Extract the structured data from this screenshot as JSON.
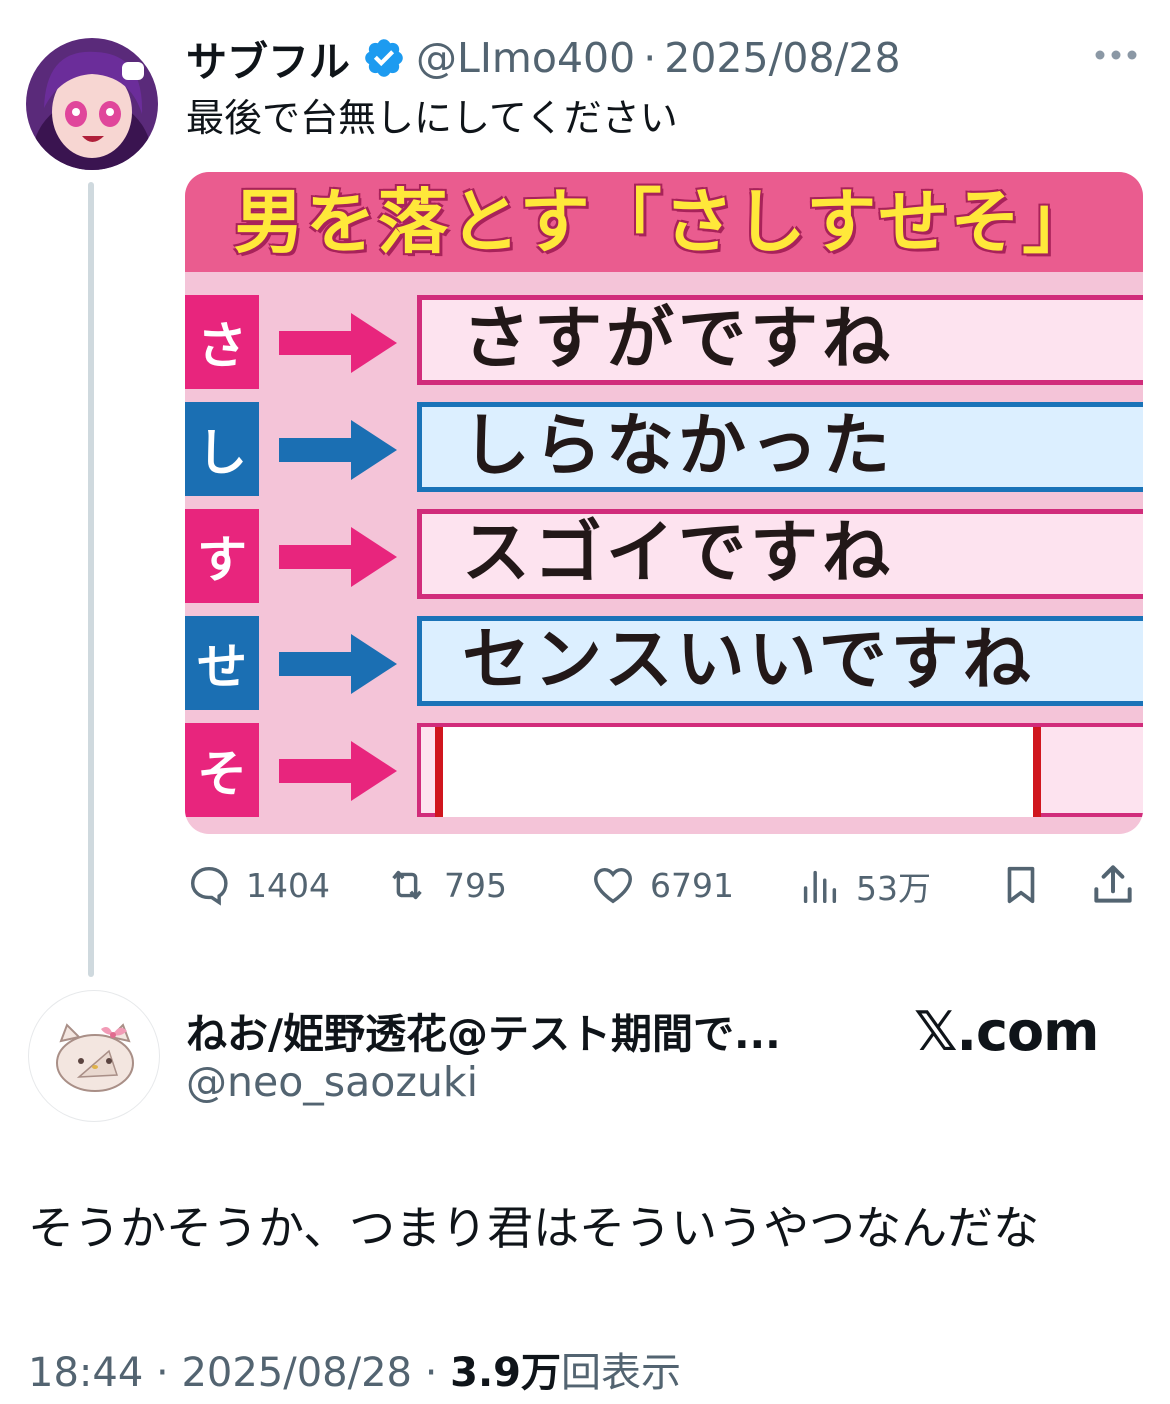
{
  "tweet": {
    "author_name": "サブフル",
    "handle": "@LImo400",
    "separator": "·",
    "date": "2025/08/28",
    "text": "最後で台無しにしてください"
  },
  "image": {
    "title": "男を落とす「さしすせそ」",
    "rows": [
      {
        "label": "さ",
        "answer": "さすがですね",
        "color": "pink"
      },
      {
        "label": "し",
        "answer": "しらなかった",
        "color": "blue"
      },
      {
        "label": "す",
        "answer": "スゴイですね",
        "color": "pink"
      },
      {
        "label": "せ",
        "answer": "センスいいですね",
        "color": "blue"
      },
      {
        "label": "そ",
        "answer": "",
        "color": "pink"
      }
    ]
  },
  "actions": {
    "replies": "1404",
    "retweets": "795",
    "likes": "6791",
    "views": "53万"
  },
  "reply_account": {
    "name": "ねお/姫野透花@テスト期間で...",
    "handle": "@neo_saozuki",
    "site": "𝕏.com"
  },
  "reply": {
    "text": "そうかそうか、つまり君はそういうやつなんだな",
    "time": "18:44",
    "separator": "·",
    "date": "2025/08/28",
    "views_count": "3.9万",
    "views_label": "回表示"
  },
  "colors": {
    "pink": "#e8257d",
    "blue": "#1b6fb3",
    "verified": "#1d9bf0",
    "muted": "#536471"
  }
}
